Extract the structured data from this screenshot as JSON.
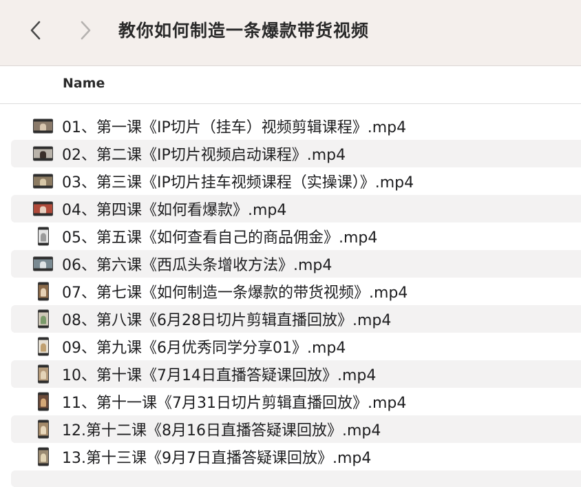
{
  "window": {
    "title": "教你如何制造一条爆款带货视频"
  },
  "toolbar": {
    "back_icon": "chevron-left-icon",
    "forward_icon": "chevron-right-icon"
  },
  "list_header": {
    "name_label": "Name"
  },
  "colors": {
    "toolbar_bg": "#f4efec",
    "alt_row_bg": "#f3f2f2"
  },
  "files": [
    {
      "name": "01、第一课《IP切片（挂车）视频剪辑课程》.mp4",
      "thumb": "landscape",
      "scene": "#8a7a6a",
      "figure": "#d9c7b0"
    },
    {
      "name": "02、第二课《IP切片视频启动课程》.mp4",
      "thumb": "landscape",
      "scene": "#b9b3aa",
      "figure": "#3a2f2a"
    },
    {
      "name": "03、第三课《IP切片挂车视频课程（实操课）》.mp4",
      "thumb": "landscape",
      "scene": "#8c7b62",
      "figure": "#d8c8a8"
    },
    {
      "name": "04、第四课《如何看爆款》.mp4",
      "thumb": "landscape",
      "scene": "#b04a3a",
      "figure": "#e8d0c0"
    },
    {
      "name": "05、第五课《如何查看自己的商品佣金》.mp4",
      "thumb": "portrait",
      "scene": "#e4e4e4",
      "figure": "#9a9a9a"
    },
    {
      "name": "06、第六课《西瓜头条增收方法》.mp4",
      "thumb": "landscape",
      "scene": "#7a8a92",
      "figure": "#e0e4e6"
    },
    {
      "name": "07、第七课《如何制造一条爆款的带货视频》.mp4",
      "thumb": "portrait",
      "scene": "#8a6a4a",
      "figure": "#e6d2b6"
    },
    {
      "name": "08、第八课《6月28日切片剪辑直播回放》.mp4",
      "thumb": "portrait",
      "scene": "#cfc8b8",
      "figure": "#7a9a6a"
    },
    {
      "name": "09、第九课《6月优秀同学分享01》.mp4",
      "thumb": "portrait",
      "scene": "#e6e0d4",
      "figure": "#c0a070"
    },
    {
      "name": "10、第十课《7月14日直播答疑课回放》.mp4",
      "thumb": "portrait",
      "scene": "#b49a7a",
      "figure": "#e4d4b8"
    },
    {
      "name": "11、第十一课《7月31日切片剪辑直播回放》.mp4",
      "thumb": "portrait",
      "scene": "#6a4a3a",
      "figure": "#d4a878"
    },
    {
      "name": "12.第十二课《8月16日直播答疑课回放》.mp4",
      "thumb": "portrait",
      "scene": "#a48a6a",
      "figure": "#e8d8bc"
    },
    {
      "name": "13.第十三课《9月7日直播答疑课回放》.mp4",
      "thumb": "portrait",
      "scene": "#9a8a72",
      "figure": "#e2d4b4"
    }
  ]
}
